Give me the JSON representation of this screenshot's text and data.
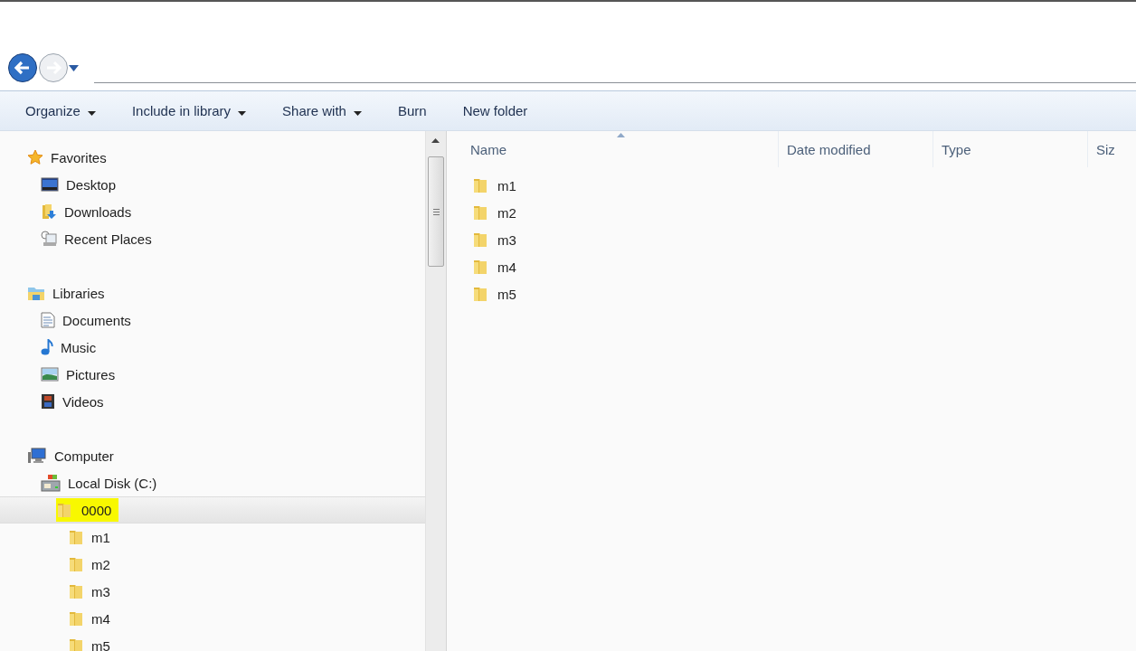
{
  "toolbar": {
    "items": [
      {
        "label": "Organize",
        "dropdown": true
      },
      {
        "label": "Include in library",
        "dropdown": true
      },
      {
        "label": "Share with",
        "dropdown": true
      },
      {
        "label": "Burn",
        "dropdown": false
      },
      {
        "label": "New folder",
        "dropdown": false
      }
    ]
  },
  "navigation_pane": {
    "groups": [
      {
        "label": "Favorites",
        "kind": "star",
        "selected": false,
        "children": [
          {
            "label": "Desktop",
            "kind": "desktop",
            "selected": false
          },
          {
            "label": "Downloads",
            "kind": "downloads",
            "selected": false
          },
          {
            "label": "Recent Places",
            "kind": "recent",
            "selected": false
          }
        ]
      },
      {
        "label": "Libraries",
        "kind": "library",
        "selected": false,
        "children": [
          {
            "label": "Documents",
            "kind": "document",
            "selected": false
          },
          {
            "label": "Music",
            "kind": "music",
            "selected": false
          },
          {
            "label": "Pictures",
            "kind": "pictures",
            "selected": false
          },
          {
            "label": "Videos",
            "kind": "videos",
            "selected": false
          }
        ]
      },
      {
        "label": "Computer",
        "kind": "computer",
        "selected": false,
        "children": [
          {
            "label": "Local Disk (C:)",
            "kind": "disk",
            "selected": false,
            "children": [
              {
                "label": "0000",
                "kind": "folder",
                "selected": true,
                "children": [
                  {
                    "label": "m1",
                    "kind": "folder",
                    "selected": false
                  },
                  {
                    "label": "m2",
                    "kind": "folder",
                    "selected": false
                  },
                  {
                    "label": "m3",
                    "kind": "folder",
                    "selected": false
                  },
                  {
                    "label": "m4",
                    "kind": "folder",
                    "selected": false
                  },
                  {
                    "label": "m5",
                    "kind": "folder",
                    "selected": false
                  }
                ]
              }
            ]
          }
        ]
      }
    ]
  },
  "file_list": {
    "columns": [
      {
        "label": "Name",
        "sorted": true
      },
      {
        "label": "Date modified",
        "sorted": false
      },
      {
        "label": "Type",
        "sorted": false
      },
      {
        "label": "Siz",
        "sorted": false
      }
    ],
    "rows": [
      {
        "name": "m1",
        "kind": "folder"
      },
      {
        "name": "m2",
        "kind": "folder"
      },
      {
        "name": "m3",
        "kind": "folder"
      },
      {
        "name": "m4",
        "kind": "folder"
      },
      {
        "name": "m5",
        "kind": "folder"
      }
    ]
  }
}
